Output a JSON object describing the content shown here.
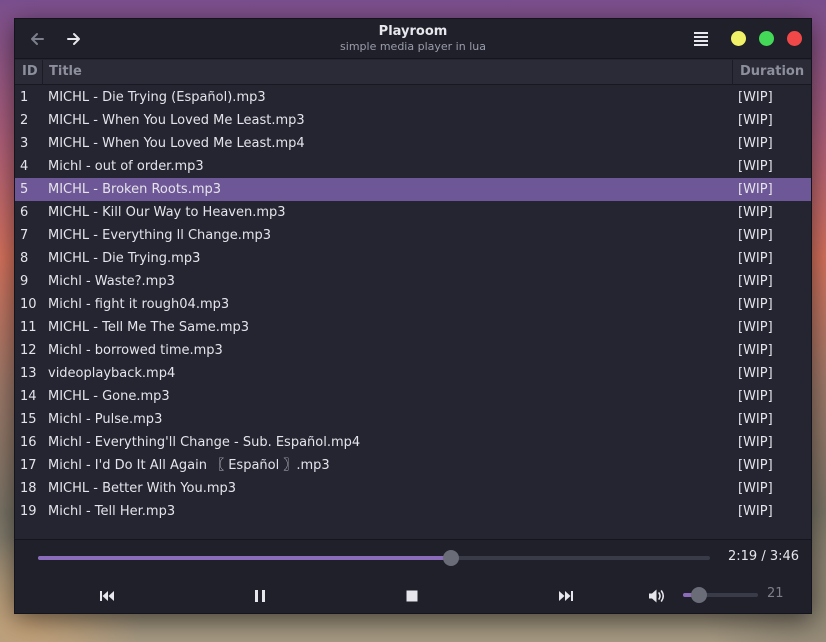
{
  "header": {
    "title": "Playroom",
    "subtitle": "simple media player in lua",
    "icons": {
      "back": "arrow-left-icon",
      "forward": "arrow-right-icon",
      "menu": "hamburger-menu-icon"
    },
    "window_controls": {
      "minimize": "#f1f168",
      "maximize": "#44d858",
      "close": "#f04848"
    }
  },
  "table": {
    "columns": {
      "id": "ID",
      "title": "Title",
      "duration": "Duration"
    },
    "selected_index": 4,
    "rows": [
      {
        "id": "1",
        "title": "MICHL - Die Trying (Español).mp3",
        "duration": "[WIP]"
      },
      {
        "id": "2",
        "title": "MICHL - When You Loved Me Least.mp3",
        "duration": "[WIP]"
      },
      {
        "id": "3",
        "title": "MICHL - When You Loved Me Least.mp4",
        "duration": "[WIP]"
      },
      {
        "id": "4",
        "title": "Michl - out of order.mp3",
        "duration": "[WIP]"
      },
      {
        "id": "5",
        "title": "MICHL - Broken Roots.mp3",
        "duration": "[WIP]"
      },
      {
        "id": "6",
        "title": "MICHL - Kill Our Way to Heaven.mp3",
        "duration": "[WIP]"
      },
      {
        "id": "7",
        "title": "MICHL - Everything ll Change.mp3",
        "duration": "[WIP]"
      },
      {
        "id": "8",
        "title": "MICHL - Die Trying.mp3",
        "duration": "[WIP]"
      },
      {
        "id": "9",
        "title": "Michl - Waste?.mp3",
        "duration": "[WIP]"
      },
      {
        "id": "10",
        "title": "Michl - fight it rough04.mp3",
        "duration": "[WIP]"
      },
      {
        "id": "11",
        "title": "MICHL - Tell Me The Same.mp3",
        "duration": "[WIP]"
      },
      {
        "id": "12",
        "title": "Michl - borrowed time.mp3",
        "duration": "[WIP]"
      },
      {
        "id": "13",
        "title": "videoplayback.mp4",
        "duration": "[WIP]"
      },
      {
        "id": "14",
        "title": "MICHL - Gone.mp3",
        "duration": "[WIP]"
      },
      {
        "id": "15",
        "title": "Michl - Pulse.mp3",
        "duration": "[WIP]"
      },
      {
        "id": "16",
        "title": "Michl - Everything'll Change - Sub. Español.mp4",
        "duration": "[WIP]"
      },
      {
        "id": "17",
        "title": "Michl - I'd Do It All Again 〖 Español 〗.mp3",
        "duration": "[WIP]"
      },
      {
        "id": "18",
        "title": "MICHL - Better With You.mp3",
        "duration": "[WIP]"
      },
      {
        "id": "19",
        "title": "Michl - Tell Her.mp3",
        "duration": "[WIP]"
      }
    ]
  },
  "player": {
    "time": "2:19 / 3:46",
    "progress_fraction": 0.615,
    "volume_label": "21",
    "volume_fraction": 0.21,
    "accent": "#8b6cbb",
    "icons": {
      "prev": "skip-previous-icon",
      "pause": "pause-icon",
      "stop": "stop-icon",
      "next": "skip-next-icon",
      "volume": "volume-icon"
    }
  }
}
